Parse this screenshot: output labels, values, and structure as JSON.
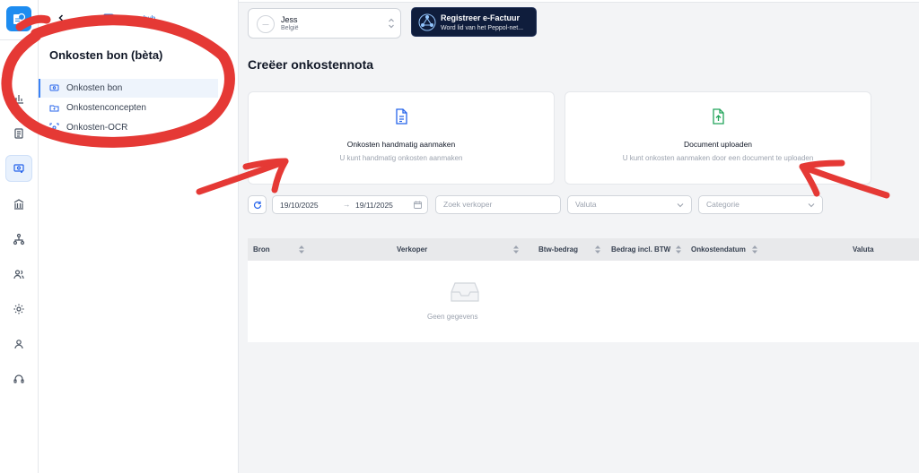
{
  "brand": {
    "name": "efactuurhub",
    "accent": "#1d8cf0"
  },
  "rail": {
    "icons": [
      "chart-icon",
      "document-icon",
      "receipt-icon",
      "bank-icon",
      "network-icon",
      "users-icon",
      "gear-icon",
      "user-icon",
      "headset-icon"
    ],
    "active": "receipt-icon"
  },
  "sidebar": {
    "title": "Onkosten bon (bèta)",
    "items": [
      {
        "label": "Onkosten bon",
        "icon": "receipt-icon",
        "active": true
      },
      {
        "label": "Onkostenconcepten",
        "icon": "folder-icon",
        "active": false
      },
      {
        "label": "Onkosten-OCR",
        "icon": "scan-icon",
        "active": false
      }
    ]
  },
  "company": {
    "name": "Jess",
    "country": "België"
  },
  "promo": {
    "title": "Registreer e-Factuur",
    "subtitle": "Word lid van het Peppol-net..."
  },
  "main": {
    "heading": "Creëer onkostennota",
    "cards": [
      {
        "title": "Onkosten handmatig aanmaken",
        "subtitle": "U kunt handmatig onkosten aanmaken",
        "icon": "document-icon"
      },
      {
        "title": "Document uploaden",
        "subtitle": "U kunt onkosten aanmaken door een document te uploaden",
        "icon": "upload-icon"
      }
    ]
  },
  "filters": {
    "date_from": "19/10/2025",
    "date_sep": "→",
    "date_to": "19/11/2025",
    "seller_placeholder": "Zoek verkoper",
    "currency_placeholder": "Valuta",
    "category_placeholder": "Categorie"
  },
  "table": {
    "columns": [
      "Bron",
      "Verkoper",
      "Btw-bedrag",
      "Bedrag incl. BTW",
      "Onkostendatum",
      "Valuta"
    ],
    "empty_text": "Geen gegevens"
  },
  "annotation_color": "#e53935"
}
